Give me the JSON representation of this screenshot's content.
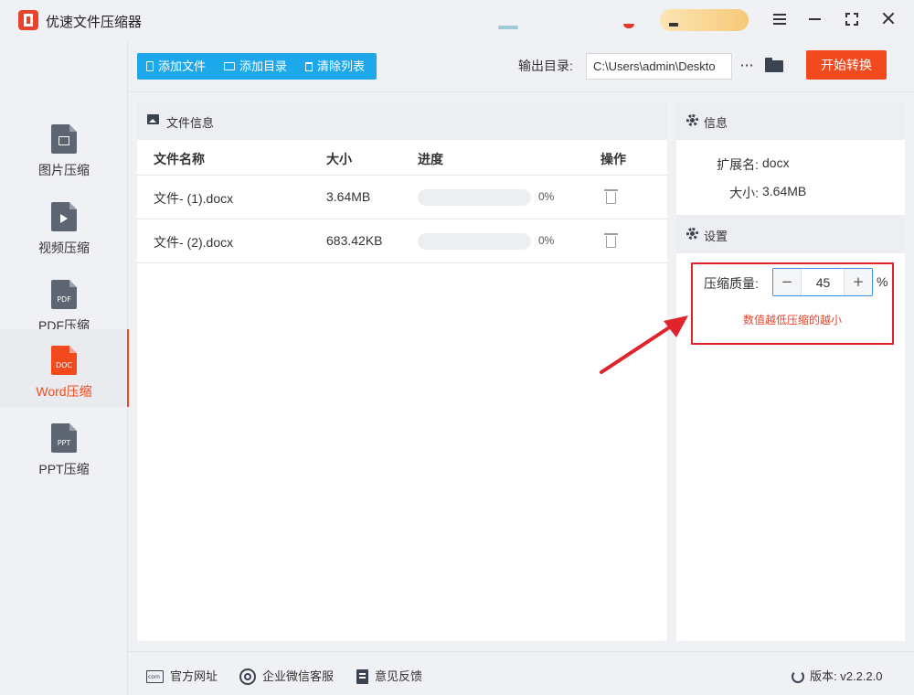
{
  "app": {
    "title": "优速文件压缩器"
  },
  "sidebar": {
    "items": [
      {
        "label": "图片压缩",
        "icon": "image-file-icon",
        "tag": ""
      },
      {
        "label": "视频压缩",
        "icon": "video-file-icon",
        "tag": ""
      },
      {
        "label": "PDF压缩",
        "icon": "pdf-file-icon",
        "tag": "PDF"
      },
      {
        "label": "Word压缩",
        "icon": "doc-file-icon",
        "tag": "DOC",
        "active": true
      },
      {
        "label": "PPT压缩",
        "icon": "ppt-file-icon",
        "tag": "PPT"
      }
    ]
  },
  "toolbar": {
    "add_file": "添加文件",
    "add_folder": "添加目录",
    "clear_list": "清除列表",
    "output_label": "输出目录:",
    "output_path": "C:\\Users\\admin\\Deskto",
    "more": "···",
    "start": "开始转换"
  },
  "file_panel": {
    "title": "文件信息",
    "columns": [
      "文件名称",
      "大小",
      "进度",
      "操作"
    ],
    "rows": [
      {
        "name": "文件- (1).docx",
        "size": "3.64MB",
        "progress": 0,
        "progress_text": "0%"
      },
      {
        "name": "文件- (2).docx",
        "size": "683.42KB",
        "progress": 0,
        "progress_text": "0%"
      }
    ]
  },
  "info_panel": {
    "title": "信息",
    "ext_label": "扩展名:",
    "ext_value": "docx",
    "size_label": "大小:",
    "size_value": "3.64MB"
  },
  "settings_panel": {
    "title": "设置",
    "quality_label": "压缩质量:",
    "quality_value": "45",
    "minus": "−",
    "plus": "+",
    "unit": "%",
    "hint": "数值越低压缩的越小"
  },
  "footer": {
    "website": "官方网址",
    "wechat": "企业微信客服",
    "feedback": "意见反馈",
    "version_label": "版本:",
    "version_value": "v2.2.2.0"
  },
  "colors": {
    "accent": "#f24a1c",
    "primary_blue": "#1ea8ec",
    "highlight_box": "#e0242c",
    "hint_text": "#e8442d"
  }
}
